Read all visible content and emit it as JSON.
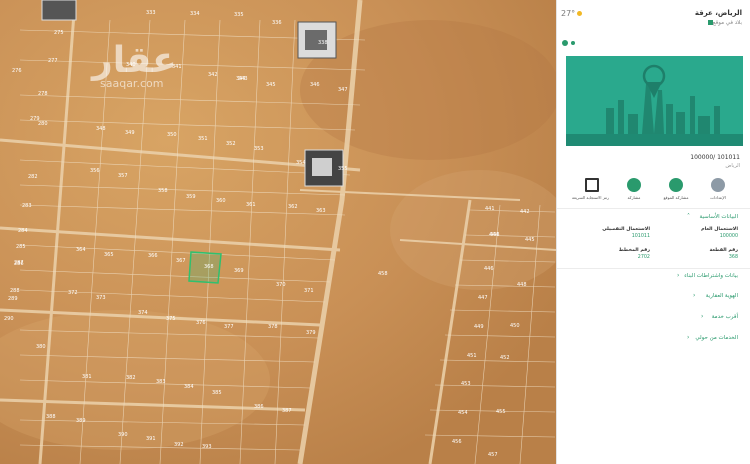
{
  "map": {
    "watermark": "عقار",
    "watermark_sub": "saaqar.com",
    "background_color": "#c9955a",
    "selected_plot": "368",
    "plot_labels": [
      "333",
      "334",
      "335",
      "336",
      "275",
      "276",
      "277",
      "278",
      "279",
      "280",
      "338",
      "340",
      "341",
      "342",
      "343",
      "344",
      "345",
      "346",
      "347",
      "348",
      "349",
      "350",
      "351",
      "352",
      "353",
      "354",
      "355",
      "356",
      "357",
      "358",
      "359",
      "360",
      "361",
      "362",
      "363",
      "364",
      "365",
      "366",
      "367",
      "368",
      "369",
      "370",
      "371",
      "372",
      "373",
      "374",
      "375",
      "376",
      "377",
      "378",
      "379",
      "380",
      "381",
      "382",
      "383",
      "384",
      "385",
      "386",
      "387",
      "388",
      "389",
      "390",
      "391",
      "392",
      "393",
      "282",
      "283",
      "284",
      "285",
      "286",
      "287",
      "288",
      "289",
      "290",
      "441",
      "442",
      "443",
      "444",
      "445",
      "446",
      "447",
      "448",
      "449",
      "450",
      "451",
      "452",
      "453",
      "454",
      "455",
      "456",
      "457",
      "458"
    ]
  },
  "panel": {
    "temperature": "27°",
    "location_title": "الرياض، عرقة",
    "location_subtitle": "بلاد في موقع",
    "price": "100000/ 101011",
    "city": "الرياض",
    "actions": [
      {
        "label": "الإعدادات",
        "icon": "settings-icon"
      },
      {
        "label": "مشاركة الموقع",
        "icon": "bookmark-icon"
      },
      {
        "label": "مشاركة",
        "icon": "share-icon"
      },
      {
        "label": "رمز الاستجابة السريعة",
        "icon": "qr-code-icon"
      }
    ],
    "section_basic": "البيانات الأساسية",
    "fields": {
      "general_use_label": "الاستعمال العام",
      "general_use_value": "100000",
      "detailed_use_label": "الاستعمال التفصيلي",
      "detailed_use_value": "101011",
      "plot_no_label": "رقم القطعة",
      "plot_no_value": "368",
      "plan_no_label": "رقم المخطط",
      "plan_no_value": "2702"
    },
    "sections": [
      "بيانات واشتراطات البناء",
      "الهوية العقارية",
      "أقرب خدمة",
      "الخدمات من حولي"
    ],
    "accent_color": "#2a9a6d"
  }
}
